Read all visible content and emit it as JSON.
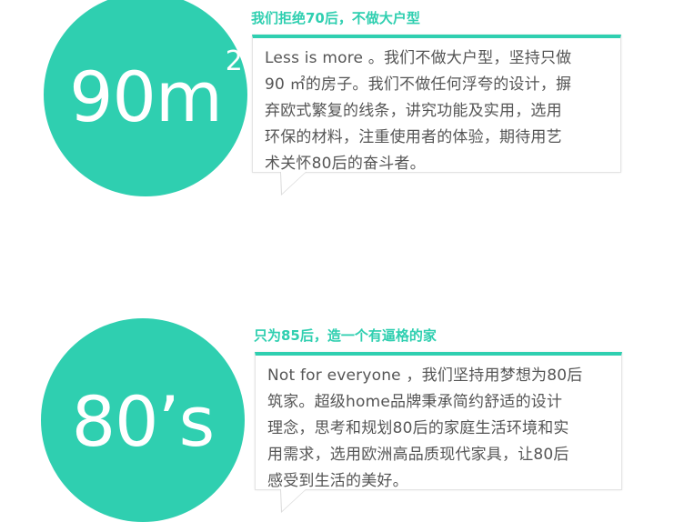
{
  "section1": {
    "big_value": "90m",
    "big_superscript": "2",
    "heading": "我们拒绝70后，不做大户型",
    "body": "Less is more 。我们不做大户型，坚持只做\n90 ㎡的房子。我们不做任何浮夸的设计，摒\n弃欧式繁复的线条，讲究功能及实用，选用\n环保的材料，注重使用者的体验，期待用艺\n术关怀80后的奋斗者。"
  },
  "section2": {
    "big_value": "80’s",
    "heading": "只为85后，造一个有逼格的家",
    "body": "Not for everyone ，我们坚持用梦想为80后\n筑家。超级home品牌秉承简约舒适的设计\n理念，思考和规划80后的家庭生活环境和实\n用需求，选用欧洲高品质现代家具，让80后\n感受到生活的美好。"
  },
  "colors": {
    "accent": "#2fcfb0",
    "text": "#555555"
  }
}
